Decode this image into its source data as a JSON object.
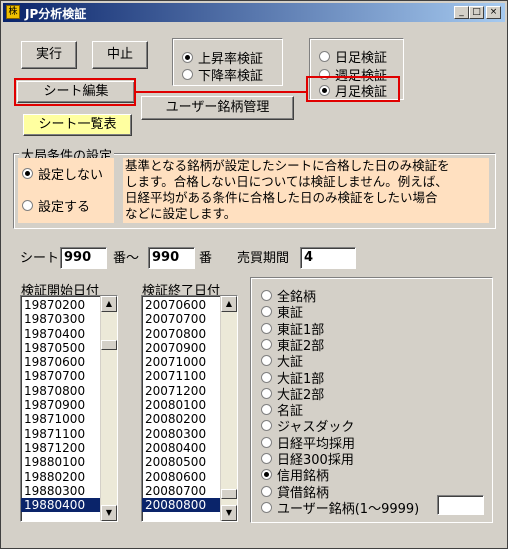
{
  "window": {
    "title": "JP分析検証",
    "icon_glyph": "株",
    "minimize_glyph": "_",
    "maximize_glyph": "□",
    "close_glyph": "×"
  },
  "buttons": {
    "run": "実行",
    "stop": "中止",
    "sheet_edit": "シート編集",
    "user_stock_mgmt": "ユーザー銘柄管理",
    "sheet_list": "シート一覧表"
  },
  "direction_group": {
    "options": [
      "上昇率検証",
      "下降率検証"
    ],
    "selected": 0
  },
  "period_group": {
    "options": [
      "日足検証",
      "週足検証",
      "月足検証"
    ],
    "selected": 2
  },
  "market_condition": {
    "title": "大局条件の設定",
    "options": [
      "設定しない",
      "設定する"
    ],
    "selected": 0,
    "description": [
      "基準となる銘柄が設定したシートに合格した日のみ検証を",
      "します。合格しない日については検証しません。例えば、",
      "日経平均がある条件に合格した日のみ検証をしたい場合",
      "などに設定します。"
    ]
  },
  "sheet_range": {
    "label": "シート",
    "from": "990",
    "sep": "番～",
    "to": "990",
    "suffix": "番",
    "period_label": "売買期間",
    "period_value": "4"
  },
  "start_list": {
    "header": "検証開始日付",
    "items": [
      "19870200",
      "19870300",
      "19870400",
      "19870500",
      "19870600",
      "19870700",
      "19870800",
      "19870900",
      "19871000",
      "19871100",
      "19871200",
      "19880100",
      "19880200",
      "19880300",
      "19880400"
    ],
    "selected": 14
  },
  "end_list": {
    "header": "検証終了日付",
    "items": [
      "20070600",
      "20070700",
      "20070800",
      "20070900",
      "20071000",
      "20071100",
      "20071200",
      "20080100",
      "20080200",
      "20080300",
      "20080400",
      "20080500",
      "20080600",
      "20080700",
      "20080800"
    ],
    "selected": 14
  },
  "stock_group": {
    "options": [
      "全銘柄",
      "東証",
      "東証1部",
      "東証2部",
      "大証",
      "大証1部",
      "大証2部",
      "名証",
      "ジャスダック",
      "日経平均採用",
      "日経300採用",
      "信用銘柄",
      "貸借銘柄",
      "ユーザー銘柄(1～9999)"
    ],
    "selected": 11,
    "user_value": ""
  }
}
